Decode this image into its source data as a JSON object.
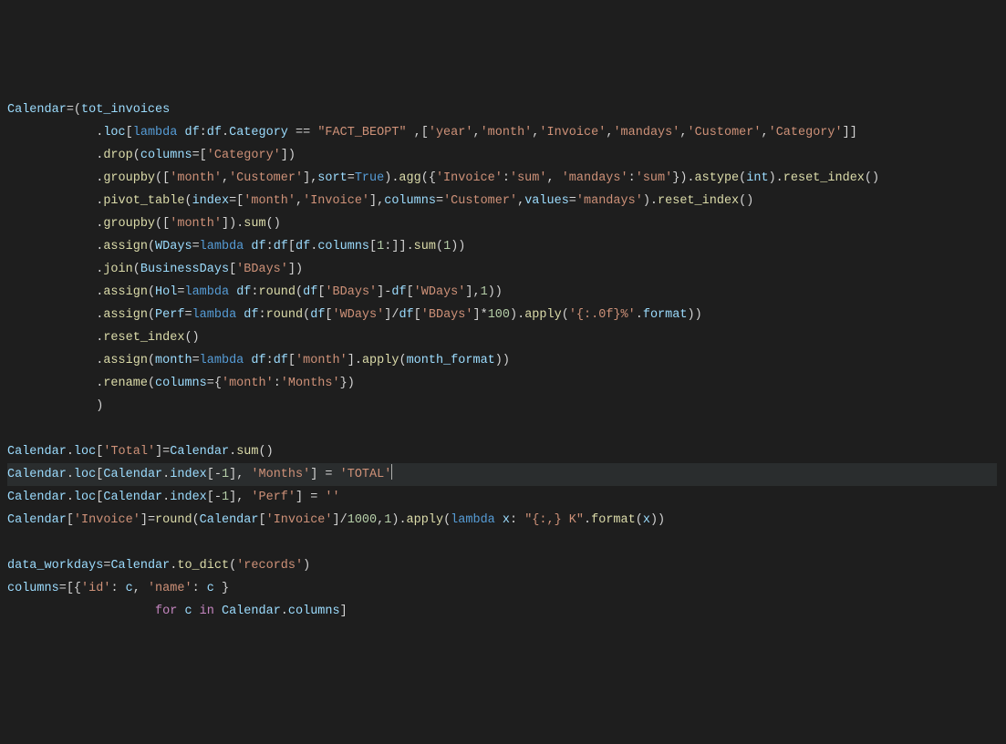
{
  "code": {
    "l1": {
      "a": "Calendar",
      "b": "tot_invoices"
    },
    "l2": {
      "a": "loc",
      "b": "lambda",
      "c": "df",
      "d": "df",
      "e": "Category",
      "f": "\"FACT_BEOPT\"",
      "g": "'year'",
      "h": "'month'",
      "i": "'Invoice'",
      "j": "'mandays'",
      "k": "'Customer'",
      "l": "'Category'"
    },
    "l3": {
      "a": "drop",
      "b": "columns",
      "c": "'Category'"
    },
    "l4": {
      "a": "groupby",
      "b": "'month'",
      "c": "'Customer'",
      "d": "sort",
      "e": "True",
      "f": "agg",
      "g": "'Invoice'",
      "h": "'sum'",
      "i": "'mandays'",
      "j": "'sum'",
      "k": "astype",
      "l": "int",
      "m": "reset_index"
    },
    "l5": {
      "a": "pivot_table",
      "b": "index",
      "c": "'month'",
      "d": "'Invoice'",
      "e": "columns",
      "f": "'Customer'",
      "g": "values",
      "h": "'mandays'",
      "i": "reset_index"
    },
    "l6": {
      "a": "groupby",
      "b": "'month'",
      "c": "sum"
    },
    "l7": {
      "a": "assign",
      "b": "WDays",
      "c": "lambda",
      "d": "df",
      "e": "df",
      "f": "df",
      "g": "columns",
      "h": "1",
      "i": "sum",
      "j": "1"
    },
    "l8": {
      "a": "join",
      "b": "BusinessDays",
      "c": "'BDays'"
    },
    "l9": {
      "a": "assign",
      "b": "Hol",
      "c": "lambda",
      "d": "df",
      "e": "round",
      "f": "df",
      "g": "'BDays'",
      "h": "df",
      "i": "'WDays'",
      "j": "1"
    },
    "l10": {
      "a": "assign",
      "b": "Perf",
      "c": "lambda",
      "d": "df",
      "e": "round",
      "f": "df",
      "g": "'WDays'",
      "h": "df",
      "i": "'BDays'",
      "j": "100",
      "k": "apply",
      "l": "'{:.0f}%'",
      "m": "format"
    },
    "l11": {
      "a": "reset_index"
    },
    "l12": {
      "a": "assign",
      "b": "month",
      "c": "lambda",
      "d": "df",
      "e": "df",
      "f": "'month'",
      "g": "apply",
      "h": "month_format"
    },
    "l13": {
      "a": "rename",
      "b": "columns",
      "c": "'month'",
      "d": "'Months'"
    },
    "l16": {
      "a": "Calendar",
      "b": "loc",
      "c": "'Total'",
      "d": "Calendar",
      "e": "sum"
    },
    "l17": {
      "a": "Calendar",
      "b": "loc",
      "c": "Calendar",
      "d": "index",
      "e": "1",
      "f": "'Months'",
      "g": "'TOTAL'"
    },
    "l18": {
      "a": "Calendar",
      "b": "loc",
      "c": "Calendar",
      "d": "index",
      "e": "1",
      "f": "'Perf'",
      "g": "''"
    },
    "l19": {
      "a": "Calendar",
      "b": "'Invoice'",
      "c": "round",
      "d": "Calendar",
      "e": "'Invoice'",
      "f": "1000",
      "g": "1",
      "h": "apply",
      "i": "lambda",
      "j": "x",
      "k": "\"{:,} K\"",
      "l": "format",
      "m": "x"
    },
    "l21": {
      "a": "data_workdays",
      "b": "Calendar",
      "c": "to_dict",
      "d": "'records'"
    },
    "l22": {
      "a": "columns",
      "b": "'id'",
      "c": "c",
      "d": "'name'",
      "e": "c"
    },
    "l23": {
      "a": "for",
      "b": "c",
      "c": "in",
      "d": "Calendar",
      "e": "columns"
    }
  }
}
